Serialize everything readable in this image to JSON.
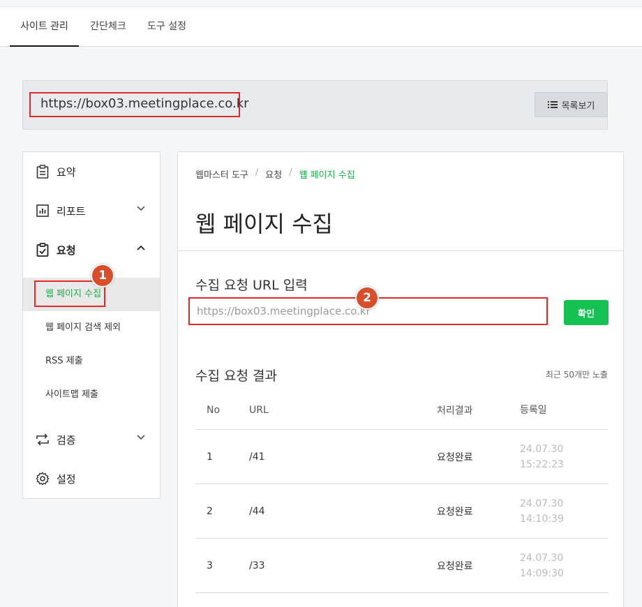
{
  "nav": {
    "tabs": [
      {
        "label": "사이트 관리",
        "active": true
      },
      {
        "label": "간단체크",
        "active": false
      },
      {
        "label": "도구 설정",
        "active": false
      }
    ]
  },
  "site": {
    "url": "https://box03.meetingplace.co.kr",
    "list_button": "목록보기"
  },
  "sidebar": {
    "items": [
      {
        "label": "요약",
        "icon": "clipboard-icon"
      },
      {
        "label": "리포트",
        "icon": "bar-chart-icon",
        "expand": "chevron-down-icon"
      },
      {
        "label": "요청",
        "icon": "clipboard-check-icon",
        "expand": "chevron-up-icon"
      },
      {
        "label": "검증",
        "icon": "repeat-icon",
        "expand": "chevron-down-icon"
      },
      {
        "label": "설정",
        "icon": "gear-icon"
      }
    ],
    "sub_items": [
      {
        "label": "웹 페이지 수집",
        "active": true
      },
      {
        "label": "웹 페이지 검색 제외"
      },
      {
        "label": "RSS 제출"
      },
      {
        "label": "사이트맵 제출"
      }
    ]
  },
  "main": {
    "breadcrumb": [
      "웹마스터 도구",
      "요청",
      "웹 페이지 수집"
    ],
    "title": "웹 페이지 수집",
    "input_section": "수집 요청 URL 입력",
    "input_placeholder": "https://box03.meetingplace.co.kr",
    "confirm_button": "확인",
    "result_section": "수집 요청 결과",
    "result_note": "최근 50개만 노출",
    "table": {
      "headers": [
        "No",
        "URL",
        "처리결과",
        "등록일"
      ],
      "rows": [
        {
          "no": "1",
          "url": "/41",
          "result": "요청완료",
          "date": "24.07.30 15:22:23"
        },
        {
          "no": "2",
          "url": "/44",
          "result": "요청완료",
          "date": "24.07.30 14:10:39"
        },
        {
          "no": "3",
          "url": "/33",
          "result": "요청완료",
          "date": "24.07.30 14:09:30"
        }
      ]
    }
  },
  "annotations": {
    "badge_1": "1",
    "badge_2": "2"
  },
  "colors": {
    "accent_green": "#15c152",
    "highlight_red": "#e02a2a",
    "badge_orange": "#d94e2a"
  }
}
